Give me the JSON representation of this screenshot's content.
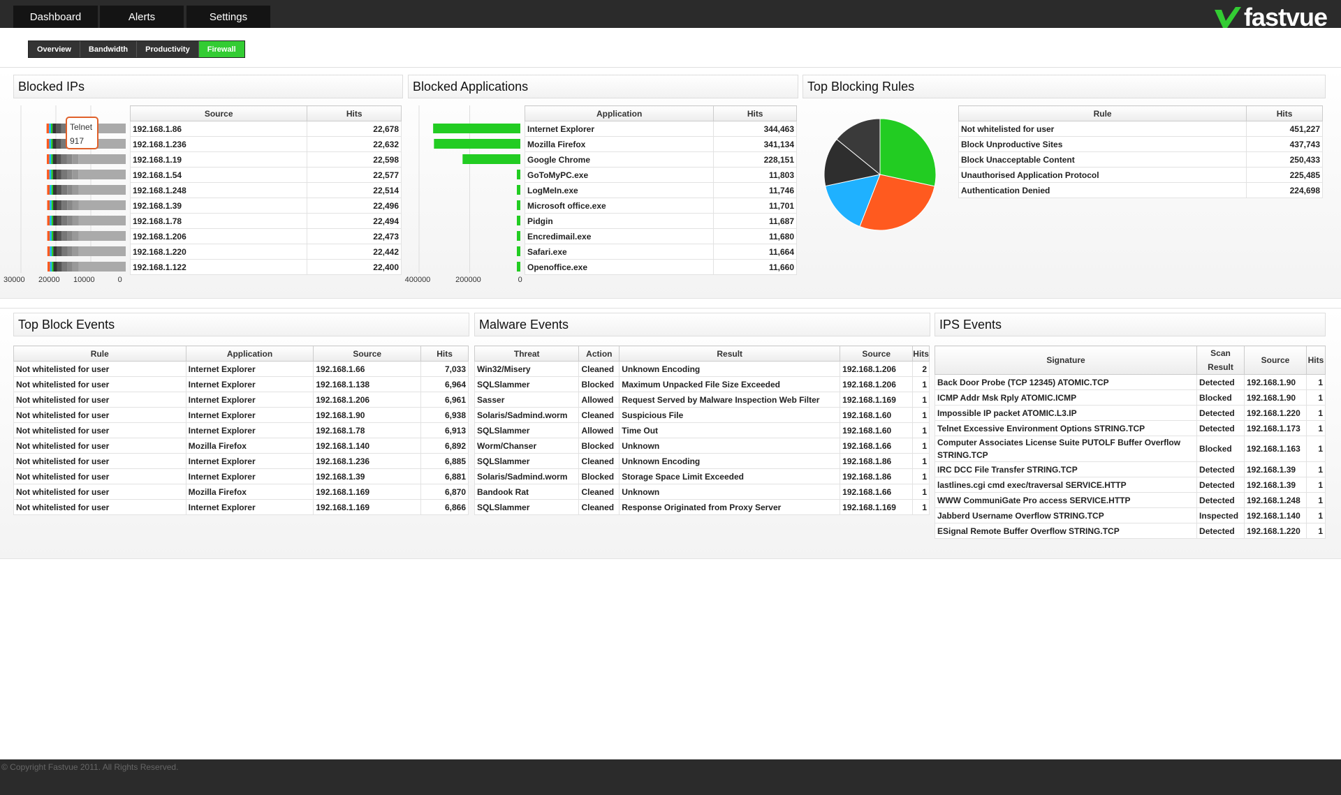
{
  "nav": {
    "dashboard": "Dashboard",
    "alerts": "Alerts",
    "settings": "Settings"
  },
  "logo": {
    "text": "fastvue",
    "icon": "check-arrow-icon"
  },
  "subnav": [
    "Overview",
    "Bandwidth",
    "Productivity",
    "Firewall"
  ],
  "subnav_active": "Firewall",
  "colors": {
    "accent": "#33cc33",
    "orange": "#ff5a1f",
    "blue": "#1fb1ff",
    "dark": "#333333",
    "gray": "#aaaaaa"
  },
  "blocked_ips": {
    "title": "Blocked IPs",
    "columns": [
      "Source",
      "Hits"
    ],
    "rows": [
      [
        "192.168.1.86",
        "22,678"
      ],
      [
        "192.168.1.236",
        "22,632"
      ],
      [
        "192.168.1.19",
        "22,598"
      ],
      [
        "192.168.1.54",
        "22,577"
      ],
      [
        "192.168.1.248",
        "22,514"
      ],
      [
        "192.168.1.39",
        "22,496"
      ],
      [
        "192.168.1.78",
        "22,494"
      ],
      [
        "192.168.1.206",
        "22,473"
      ],
      [
        "192.168.1.220",
        "22,442"
      ],
      [
        "192.168.1.122",
        "22,400"
      ]
    ],
    "axis_ticks": [
      "30000",
      "20000",
      "10000",
      "0"
    ],
    "tooltip": {
      "label": "Telnet",
      "value": "917"
    }
  },
  "blocked_apps": {
    "title": "Blocked Applications",
    "columns": [
      "Application",
      "Hits"
    ],
    "rows": [
      [
        "Internet Explorer",
        "344,463"
      ],
      [
        "Mozilla Firefox",
        "341,134"
      ],
      [
        "Google Chrome",
        "228,151"
      ],
      [
        "GoToMyPC.exe",
        "11,803"
      ],
      [
        "LogMeIn.exe",
        "11,746"
      ],
      [
        "Microsoft office.exe",
        "11,701"
      ],
      [
        "Pidgin",
        "11,687"
      ],
      [
        "Encredimail.exe",
        "11,680"
      ],
      [
        "Safari.exe",
        "11,664"
      ],
      [
        "Openoffice.exe",
        "11,660"
      ]
    ],
    "axis_ticks": [
      "400000",
      "200000",
      "0"
    ]
  },
  "top_rules": {
    "title": "Top Blocking Rules",
    "columns": [
      "Rule",
      "Hits"
    ],
    "rows": [
      [
        "Not whitelisted for user",
        "451,227"
      ],
      [
        "Block Unproductive Sites",
        "437,743"
      ],
      [
        "Block Unacceptable Content",
        "250,433"
      ],
      [
        "Unauthorised Application Protocol",
        "225,485"
      ],
      [
        "Authentication Denied",
        "224,698"
      ]
    ]
  },
  "chart_data": [
    {
      "type": "bar",
      "orientation": "horizontal",
      "title": "Blocked Applications",
      "categories": [
        "Internet Explorer",
        "Mozilla Firefox",
        "Google Chrome",
        "GoToMyPC.exe",
        "LogMeIn.exe",
        "Microsoft office.exe",
        "Pidgin",
        "Encredimail.exe",
        "Safari.exe",
        "Openoffice.exe"
      ],
      "values": [
        344463,
        341134,
        228151,
        11803,
        11746,
        11701,
        11687,
        11680,
        11664,
        11660
      ],
      "xlim": [
        0,
        400000
      ],
      "color": "#22cc22"
    },
    {
      "type": "bar",
      "orientation": "horizontal",
      "stacked": true,
      "title": "Blocked IPs",
      "categories": [
        "192.168.1.86",
        "192.168.1.236",
        "192.168.1.19",
        "192.168.1.54",
        "192.168.1.248",
        "192.168.1.39",
        "192.168.1.78",
        "192.168.1.206",
        "192.168.1.220",
        "192.168.1.122"
      ],
      "values": [
        22678,
        22632,
        22598,
        22577,
        22514,
        22496,
        22494,
        22473,
        22442,
        22400
      ],
      "xlim": [
        0,
        30000
      ]
    },
    {
      "type": "pie",
      "title": "Top Blocking Rules",
      "labels": [
        "Not whitelisted for user",
        "Block Unproductive Sites",
        "Block Unacceptable Content",
        "Unauthorised Application Protocol",
        "Authentication Denied"
      ],
      "values": [
        451227,
        437743,
        250433,
        225485,
        224698
      ],
      "colors": [
        "#22cc22",
        "#ff5a1f",
        "#1fb1ff",
        "#2e2e2e",
        "#3a3a3a"
      ]
    }
  ],
  "top_block_events": {
    "title": "Top Block Events",
    "columns": [
      "Rule",
      "Application",
      "Source",
      "Hits"
    ],
    "rows": [
      [
        "Not whitelisted for user",
        "Internet Explorer",
        "192.168.1.66",
        "7,033"
      ],
      [
        "Not whitelisted for user",
        "Internet Explorer",
        "192.168.1.138",
        "6,964"
      ],
      [
        "Not whitelisted for user",
        "Internet Explorer",
        "192.168.1.206",
        "6,961"
      ],
      [
        "Not whitelisted for user",
        "Internet Explorer",
        "192.168.1.90",
        "6,938"
      ],
      [
        "Not whitelisted for user",
        "Internet Explorer",
        "192.168.1.78",
        "6,913"
      ],
      [
        "Not whitelisted for user",
        "Mozilla Firefox",
        "192.168.1.140",
        "6,892"
      ],
      [
        "Not whitelisted for user",
        "Internet Explorer",
        "192.168.1.236",
        "6,885"
      ],
      [
        "Not whitelisted for user",
        "Internet Explorer",
        "192.168.1.39",
        "6,881"
      ],
      [
        "Not whitelisted for user",
        "Mozilla Firefox",
        "192.168.1.169",
        "6,870"
      ],
      [
        "Not whitelisted for user",
        "Internet Explorer",
        "192.168.1.169",
        "6,866"
      ]
    ]
  },
  "malware_events": {
    "title": "Malware Events",
    "columns": [
      "Threat",
      "Action",
      "Result",
      "Source",
      "Hits"
    ],
    "rows": [
      [
        "Win32/Misery",
        "Cleaned",
        "Unknown Encoding",
        "192.168.1.206",
        "2"
      ],
      [
        "SQLSlammer",
        "Blocked",
        "Maximum Unpacked File Size Exceeded",
        "192.168.1.206",
        "1"
      ],
      [
        "Sasser",
        "Allowed",
        "Request Served by Malware Inspection Web Filter",
        "192.168.1.169",
        "1"
      ],
      [
        "Solaris/Sadmind.worm",
        "Cleaned",
        "Suspicious File",
        "192.168.1.60",
        "1"
      ],
      [
        "SQLSlammer",
        "Allowed",
        "Time Out",
        "192.168.1.60",
        "1"
      ],
      [
        "Worm/Chanser",
        "Blocked",
        "Unknown",
        "192.168.1.66",
        "1"
      ],
      [
        "SQLSlammer",
        "Cleaned",
        "Unknown Encoding",
        "192.168.1.86",
        "1"
      ],
      [
        "Solaris/Sadmind.worm",
        "Blocked",
        "Storage Space Limit Exceeded",
        "192.168.1.86",
        "1"
      ],
      [
        "Bandook Rat",
        "Cleaned",
        "Unknown",
        "192.168.1.66",
        "1"
      ],
      [
        "SQLSlammer",
        "Cleaned",
        "Response Originated from Proxy Server",
        "192.168.1.169",
        "1"
      ]
    ]
  },
  "ips_events": {
    "title": "IPS Events",
    "columns": [
      "Signature",
      "Scan Result",
      "Source",
      "Hits"
    ],
    "rows": [
      [
        "Back Door Probe (TCP 12345) ATOMIC.TCP",
        "Detected",
        "192.168.1.90",
        "1"
      ],
      [
        "ICMP Addr Msk Rply ATOMIC.ICMP",
        "Blocked",
        "192.168.1.90",
        "1"
      ],
      [
        "Impossible IP packet ATOMIC.L3.IP",
        "Detected",
        "192.168.1.220",
        "1"
      ],
      [
        "Telnet Excessive Environment Options STRING.TCP",
        "Detected",
        "192.168.1.173",
        "1"
      ],
      [
        "Computer Associates License Suite PUTOLF Buffer Overflow STRING.TCP",
        "Blocked",
        "192.168.1.163",
        "1"
      ],
      [
        "IRC DCC File Transfer STRING.TCP",
        "Detected",
        "192.168.1.39",
        "1"
      ],
      [
        "lastlines.cgi cmd exec/traversal SERVICE.HTTP",
        "Detected",
        "192.168.1.39",
        "1"
      ],
      [
        "WWW CommuniGate Pro access SERVICE.HTTP",
        "Detected",
        "192.168.1.248",
        "1"
      ],
      [
        "Jabberd Username Overflow STRING.TCP",
        "Inspected",
        "192.168.1.140",
        "1"
      ],
      [
        "ESignal Remote Buffer Overflow STRING.TCP",
        "Detected",
        "192.168.1.220",
        "1"
      ]
    ]
  },
  "footer": "© Copyright Fastvue 2011. All Rights Reserved."
}
